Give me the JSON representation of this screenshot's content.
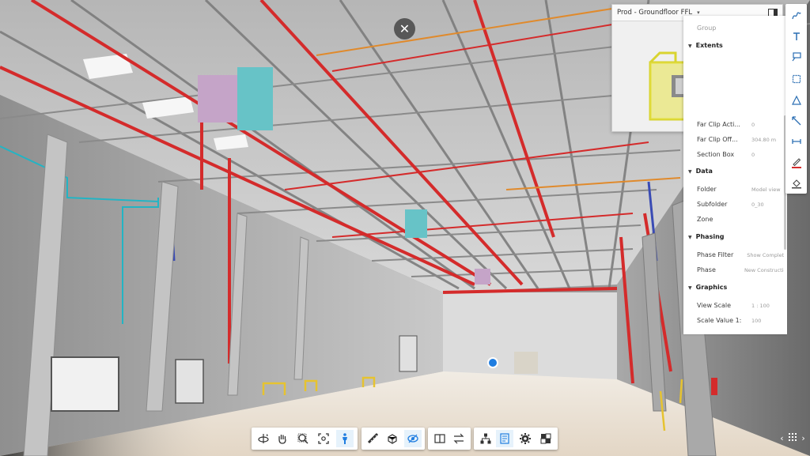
{
  "minimap": {
    "title": "Prod - Groundfloor FFL",
    "caret": "▾"
  },
  "close_icon_glyph": "✕",
  "properties": {
    "group_label": "Group",
    "extents": {
      "title": "Extents",
      "far_clip_active_label": "Far Clip Acti...",
      "far_clip_active_value": "0",
      "far_clip_offset_label": "Far Clip Off...",
      "far_clip_offset_value": "304.80 m",
      "section_box_label": "Section Box",
      "section_box_value": "0"
    },
    "data": {
      "title": "Data",
      "folder_label": "Folder",
      "folder_value": "Model view",
      "subfolder_label": "Subfolder",
      "subfolder_value": "0_30",
      "zone_label": "Zone",
      "zone_value": ""
    },
    "phasing": {
      "title": "Phasing",
      "phase_filter_label": "Phase Filter",
      "phase_filter_value": "Show Complete",
      "phase_label": "Phase",
      "phase_value": "New Construction"
    },
    "graphics": {
      "title": "Graphics",
      "view_scale_label": "View Scale",
      "view_scale_value": "1 : 100",
      "scale_value_label": "Scale Value 1:",
      "scale_value_value": "100"
    }
  },
  "right_toolbar": [
    "freehand-icon",
    "text-icon",
    "callout-icon",
    "rectangle-icon",
    "polygon-icon",
    "arrow-icon",
    "dimension-icon",
    "pen-color-icon",
    "fill-icon"
  ],
  "bottom_toolbar": {
    "group1": [
      "orbit-icon",
      "pan-icon",
      "zoom-icon",
      "fit-to-view-icon",
      "first-person-icon"
    ],
    "group2": [
      "measure-icon",
      "section-icon",
      "explode-icon"
    ],
    "group3": [
      "split-view-icon",
      "compare-icon"
    ],
    "group4": [
      "model-browser-icon",
      "properties-icon",
      "settings-icon",
      "fullscreen-icon"
    ]
  },
  "pager": {
    "prev": "‹",
    "next": "›"
  },
  "colors": {
    "pipe_red": "#d42b2b",
    "pipe_orange": "#e08a2c",
    "pipe_cyan": "#23b4c4",
    "pipe_blue": "#3a4bb4",
    "duct_teal": "#67c3c7",
    "accent_blue": "#1f7de0",
    "floor": "#ece4d8",
    "rail_yellow": "#e6c330"
  }
}
